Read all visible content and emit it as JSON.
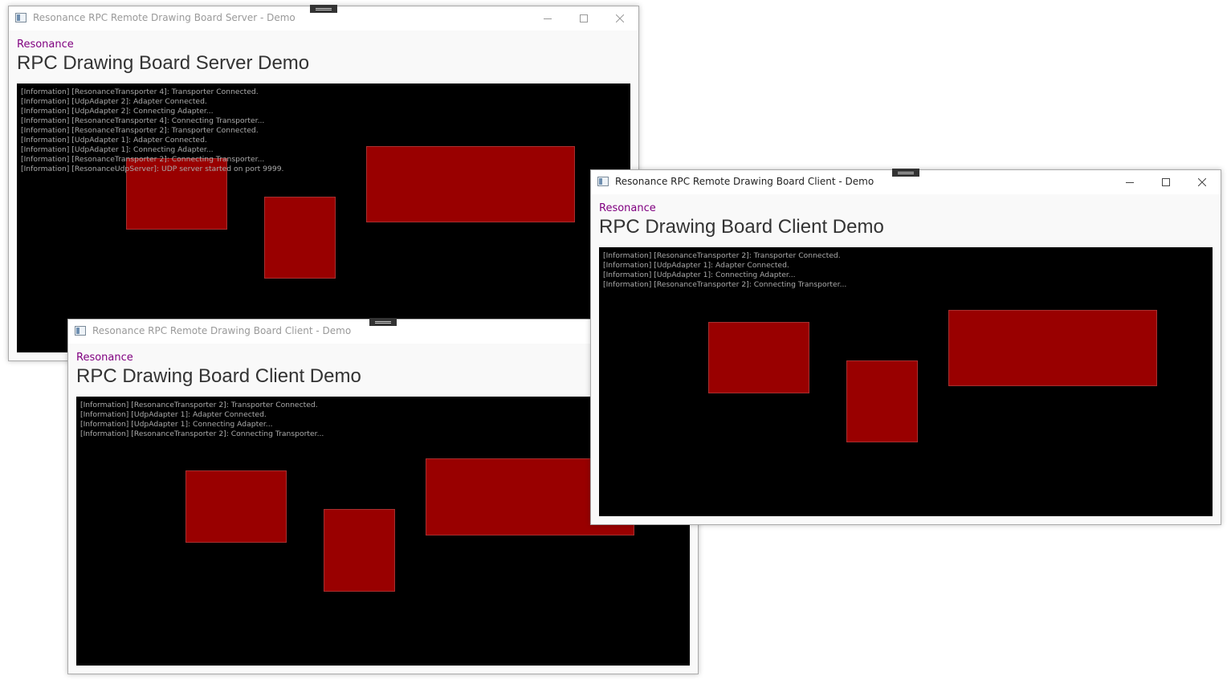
{
  "server": {
    "title": "Resonance RPC Remote Drawing Board Server - Demo",
    "brand": "Resonance",
    "heading": "RPC Drawing Board Server Demo",
    "log": [
      "[Information] [ResonanceTransporter 4]: Transporter Connected.",
      "[Information] [UdpAdapter 2]: Adapter Connected.",
      "[Information] [UdpAdapter 2]: Connecting Adapter...",
      "[Information] [ResonanceTransporter 4]: Connecting Transporter...",
      "[Information] [ResonanceTransporter 2]: Transporter Connected.",
      "[Information] [UdpAdapter 1]: Adapter Connected.",
      "[Information] [UdpAdapter 1]: Connecting Adapter...",
      "[Information] [ResonanceTransporter 2]: Connecting Transporter...",
      "[Information] [ResonanceUdpServer]: UDP server started on port 9999."
    ]
  },
  "client_left": {
    "title": "Resonance RPC Remote Drawing Board Client - Demo",
    "brand": "Resonance",
    "heading": "RPC Drawing Board Client Demo",
    "log": [
      "[Information] [ResonanceTransporter 2]: Transporter Connected.",
      "[Information] [UdpAdapter 1]: Adapter Connected.",
      "[Information] [UdpAdapter 1]: Connecting Adapter...",
      "[Information] [ResonanceTransporter 2]: Connecting Transporter..."
    ]
  },
  "client_right": {
    "title": "Resonance RPC Remote Drawing Board Client - Demo",
    "brand": "Resonance",
    "heading": "RPC Drawing Board Client Demo",
    "log": [
      "[Information] [ResonanceTransporter 2]: Transporter Connected.",
      "[Information] [UdpAdapter 1]: Adapter Connected.",
      "[Information] [UdpAdapter 1]: Connecting Adapter...",
      "[Information] [ResonanceTransporter 2]: Connecting Transporter..."
    ]
  },
  "icons": {
    "minimize": "minimize-icon",
    "maximize": "maximize-icon",
    "close": "close-icon",
    "app": "app-window-icon"
  },
  "colors": {
    "brand": "#800080",
    "board_bg": "#000000",
    "shape_fill": "#990000",
    "log_text": "#aaaaaa"
  }
}
